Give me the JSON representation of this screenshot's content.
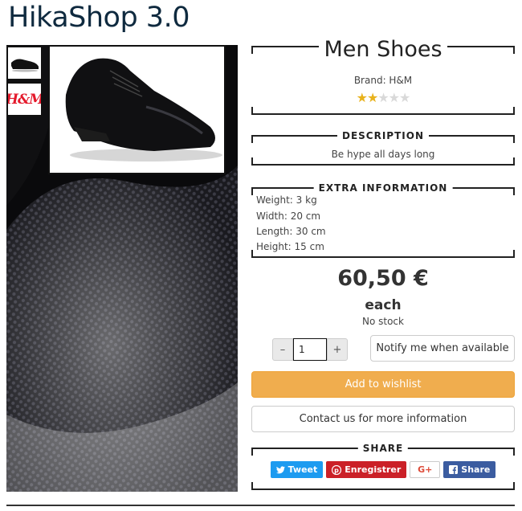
{
  "site": {
    "title": "HikaShop 3.0"
  },
  "gallery": {
    "thumb_logo_text": "H&M"
  },
  "product": {
    "name": "Men Shoes",
    "brand_line": "Brand: H&M",
    "rating": {
      "value": 2,
      "max": 5
    }
  },
  "description": {
    "heading": "DESCRIPTION",
    "text": "Be hype all days long"
  },
  "extra_info": {
    "heading": "EXTRA INFORMATION",
    "lines": [
      "Weight: 3 kg",
      "Width: 20 cm",
      "Length: 30 cm",
      "Height: 15 cm"
    ]
  },
  "pricing": {
    "price": "60,50 €",
    "unit": "each",
    "stock": "No stock"
  },
  "cart": {
    "minus": "–",
    "quantity": "1",
    "plus": "+",
    "notify_label": "Notify me when available",
    "wishlist_label": "Add to wishlist",
    "contact_label": "Contact us for more information"
  },
  "share": {
    "heading": "SHARE",
    "tweet": "Tweet",
    "pinterest": "Enregistrer",
    "google": "G+",
    "facebook": "Share"
  },
  "colors": {
    "title": "#0f2a3f",
    "wishlist": "#f0ad4e",
    "twitter": "#1d9bf0",
    "pinterest": "#cb2027",
    "facebook": "#3b5ca0"
  }
}
